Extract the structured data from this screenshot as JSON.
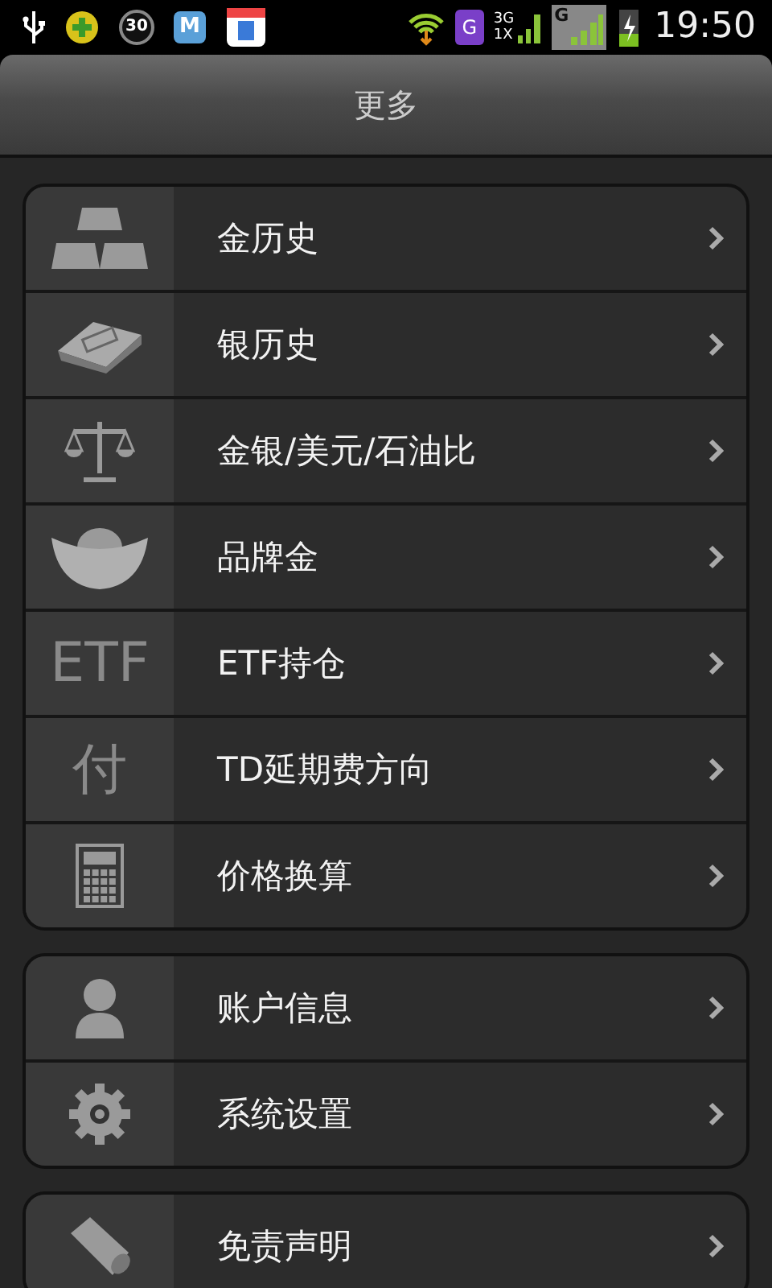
{
  "status_bar": {
    "left_icons": [
      {
        "kind": "usb"
      },
      {
        "kind": "plus"
      },
      {
        "kind": "ring",
        "text": "30"
      },
      {
        "kind": "m",
        "text": "M"
      },
      {
        "kind": "box"
      }
    ],
    "right_icons": [
      {
        "kind": "wifi"
      },
      {
        "kind": "badge",
        "text": "G"
      },
      {
        "kind": "dual",
        "text": "3G",
        "text2": "1X"
      },
      {
        "kind": "signal",
        "text": "G"
      },
      {
        "kind": "battery"
      }
    ],
    "time": "19:50"
  },
  "header": {
    "title": "更多"
  },
  "groups": [
    {
      "items": [
        {
          "kind": "gold",
          "label": "金历史"
        },
        {
          "kind": "silver",
          "label": "银历史"
        },
        {
          "kind": "scale",
          "label": "金银/美元/石油比"
        },
        {
          "kind": "ingot",
          "label": "品牌金"
        },
        {
          "kind": "text",
          "icon_text": "ETF",
          "label": "ETF持仓"
        },
        {
          "kind": "text",
          "icon_text": "付",
          "label": "TD延期费方向"
        },
        {
          "kind": "calc",
          "label": "价格换算"
        }
      ]
    },
    {
      "items": [
        {
          "kind": "person",
          "label": "账户信息"
        },
        {
          "kind": "gear",
          "label": "系统设置"
        }
      ]
    },
    {
      "items": [
        {
          "kind": "scroll",
          "label": "免责声明"
        }
      ]
    }
  ]
}
